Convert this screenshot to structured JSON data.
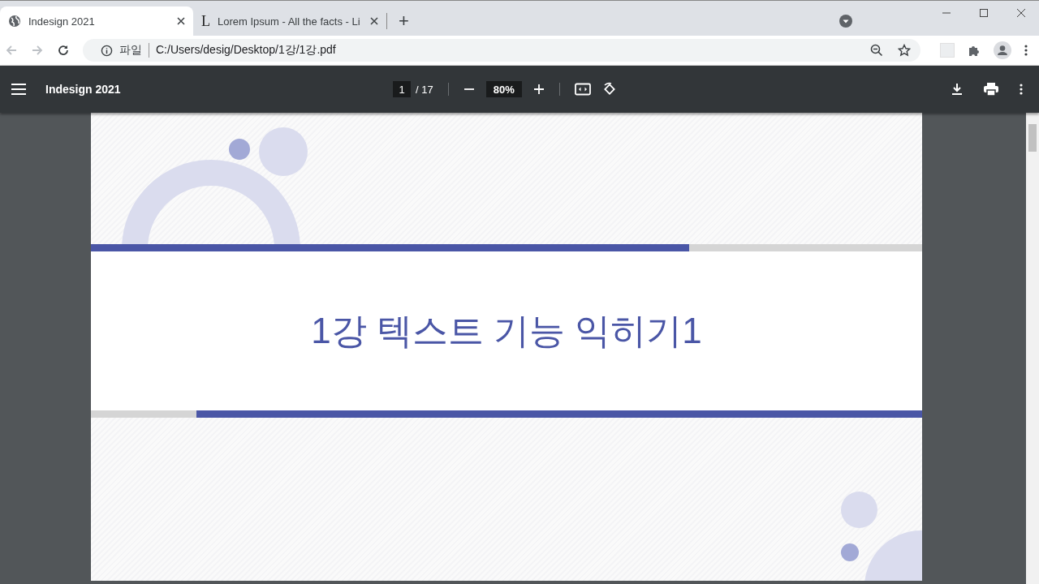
{
  "tabs": [
    {
      "title": "Indesign 2021",
      "kind": "globe",
      "selected": true
    },
    {
      "title": "Lorem Ipsum - All the facts - Li",
      "kind": "letter",
      "icon_text": "L",
      "selected": false
    }
  ],
  "new_tab": "+",
  "address_bar": {
    "scheme_label": "파일",
    "url": "C:/Users/desig/Desktop/1강/1강.pdf"
  },
  "pdf_toolbar": {
    "title": "Indesign 2021",
    "page": "1",
    "page_total": "/ 17",
    "zoom": "80%"
  },
  "document": {
    "title": "1강 텍스트 기능 익히기1"
  }
}
